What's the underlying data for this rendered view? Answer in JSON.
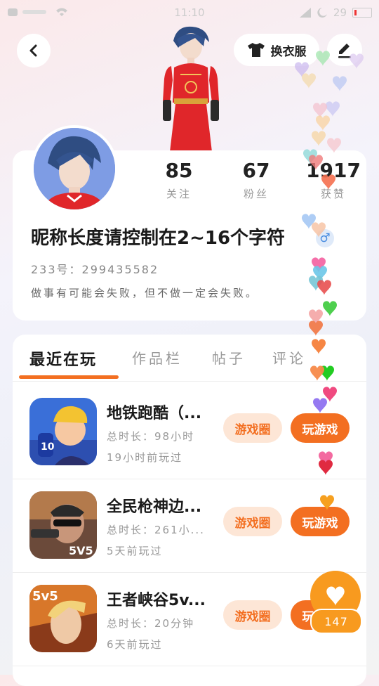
{
  "status_bar": {
    "time": "11:10",
    "battery": "29"
  },
  "header": {
    "change_outfit_label": "换衣服"
  },
  "profile": {
    "stats": [
      {
        "value": "85",
        "label": "关注"
      },
      {
        "value": "67",
        "label": "粉丝"
      },
      {
        "value": "1917",
        "label": "获赞"
      }
    ],
    "nickname": "昵称长度请控制在2~16个字符",
    "gender_symbol": "♂",
    "uid": "233号：299435582",
    "bio": "做事有可能会失败，但不做一定会失败。"
  },
  "tabs": [
    "最近在玩",
    "作品栏",
    "帖子",
    "评论"
  ],
  "games": [
    {
      "name": "地铁跑酷（...",
      "duration": "总时长：98小时",
      "last_played": "19小时前玩过",
      "community_label": "游戏圈",
      "play_label": "玩游戏"
    },
    {
      "name": "全民枪神边...",
      "duration": "总时长：261小...",
      "last_played": "5天前玩过",
      "community_label": "游戏圈",
      "play_label": "玩游戏"
    },
    {
      "name": "王者峡谷5v...",
      "duration": "总时长：20分钟",
      "last_played": "6天前玩过",
      "community_label": "游戏圈",
      "play_label": "玩游戏"
    }
  ],
  "game_icon_texts": [
    "10",
    "5V5",
    "5v5"
  ],
  "like": {
    "count": "147"
  },
  "colors": {
    "accent": "#f36f21",
    "accent_light": "#fde6d6",
    "like": "#f89a1f"
  }
}
